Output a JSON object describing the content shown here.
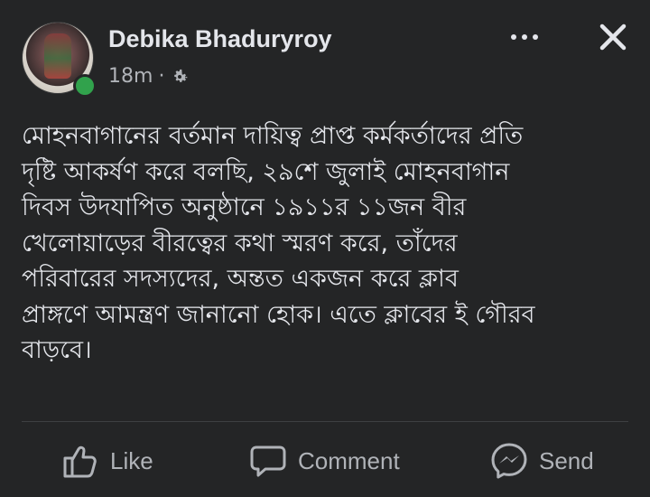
{
  "post": {
    "author": "Debika Bhaduryroy",
    "time": "18m",
    "separator": "·",
    "privacy_icon": "gear-icon",
    "body": "মোহনবাগানের বর্তমান দায়িত্ব প্রাপ্ত কর্মকর্তাদের প্রতি\nদৃষ্টি আকর্ষণ করে বলছি, ২৯শে জুলাই মোহনবাগান\nদিবস উদযাপিত অনুষ্ঠানে ১৯১১র ১১জন বীর\nখেলোয়াড়ের বীরত্বের কথা স্মরণ করে, তাঁদের\nপরিবারের সদস্যদের, অন্তত একজন করে ক্লাব\nপ্রাঙ্গণে আমন্ত্রণ জানানো হোক। এতে ক্লাবের ই গৌরব\nবাড়বে।"
  },
  "actions": {
    "like": "Like",
    "comment": "Comment",
    "send": "Send"
  },
  "colors": {
    "background": "#242526",
    "text": "#e4e6eb",
    "secondary": "#b0b3b8",
    "online": "#31a24c"
  }
}
